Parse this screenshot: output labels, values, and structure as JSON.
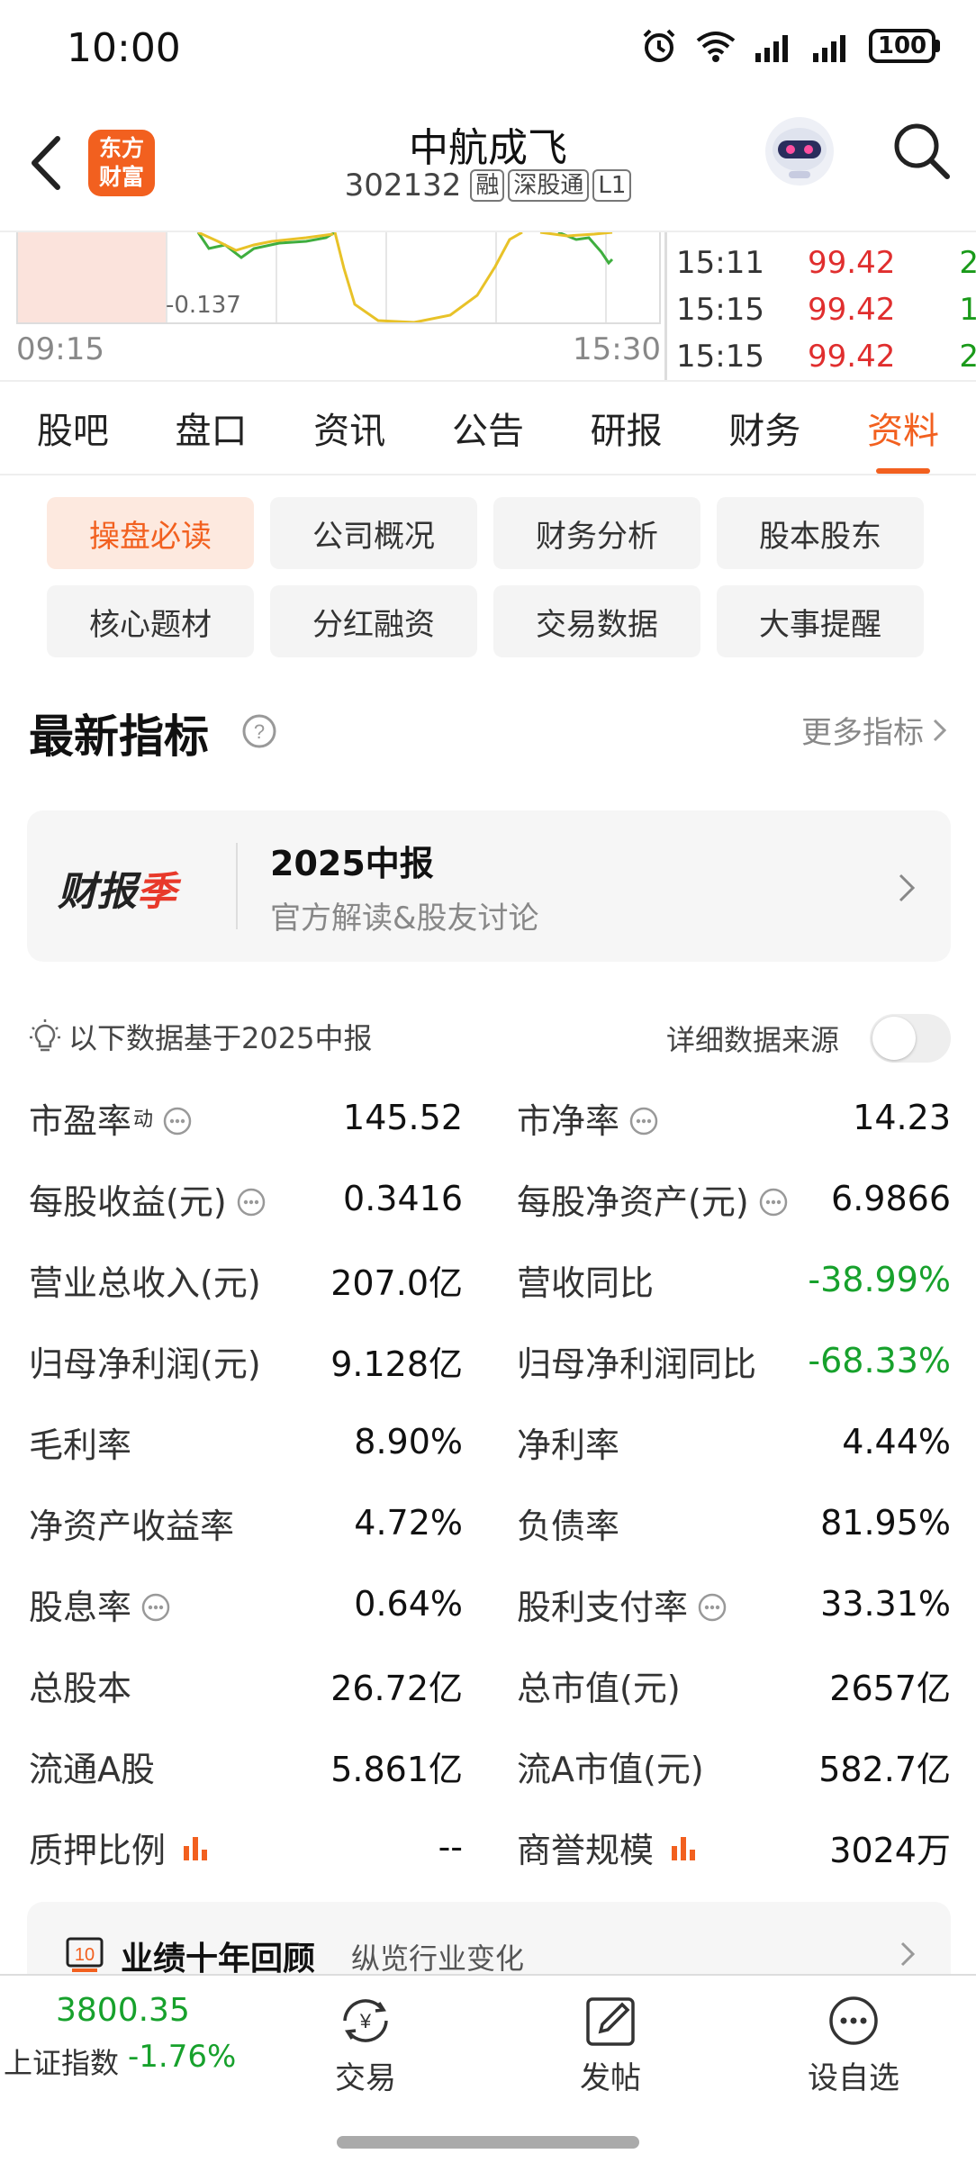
{
  "status_bar": {
    "time": "10:00",
    "battery": "100"
  },
  "header": {
    "app_logo": "东方财富",
    "stock_name": "中航成飞",
    "stock_code": "302132",
    "tags": [
      "融",
      "深股通",
      "L1"
    ]
  },
  "chart_strip": {
    "min_label": "-0.137",
    "time_start": "09:15",
    "time_end": "15:30",
    "ticks": [
      {
        "time": "15:11",
        "price": "99.42",
        "vol": "2"
      },
      {
        "time": "15:15",
        "price": "99.42",
        "vol": "1"
      },
      {
        "time": "15:15",
        "price": "99.42",
        "vol": "2"
      }
    ]
  },
  "tabs": [
    "股吧",
    "盘口",
    "资讯",
    "公告",
    "研报",
    "财务",
    "资料"
  ],
  "active_tab": "资料",
  "subtabs": [
    "操盘必读",
    "公司概况",
    "财务分析",
    "股本股东",
    "核心题材",
    "分红融资",
    "交易数据",
    "大事提醒"
  ],
  "section": {
    "title": "最新指标",
    "more": "更多指标"
  },
  "banner": {
    "logo_black": "财报",
    "logo_red": "季",
    "title": "2025中报",
    "subtitle": "官方解读&股友讨论"
  },
  "note": {
    "text": "以下数据基于2025中报",
    "source_label": "详细数据来源"
  },
  "metrics": [
    {
      "l_label": "市盈率",
      "l_sup": "动",
      "l_info": true,
      "l_value": "145.52",
      "r_label": "市净率",
      "r_info": true,
      "r_value": "14.23"
    },
    {
      "l_label": "每股收益(元)",
      "l_info": true,
      "l_value": "0.3416",
      "r_label": "每股净资产(元)",
      "r_info": true,
      "r_value": "6.9866"
    },
    {
      "l_label": "营业总收入(元)",
      "l_value": "207.0亿",
      "r_label": "营收同比",
      "r_value": "-38.99%",
      "r_green": true
    },
    {
      "l_label": "归母净利润(元)",
      "l_value": "9.128亿",
      "r_label": "归母净利润同比",
      "r_value": "-68.33%",
      "r_green": true
    },
    {
      "l_label": "毛利率",
      "l_value": "8.90%",
      "r_label": "净利率",
      "r_value": "4.44%"
    },
    {
      "l_label": "净资产收益率",
      "l_value": "4.72%",
      "r_label": "负债率",
      "r_value": "81.95%"
    },
    {
      "l_label": "股息率",
      "l_info": true,
      "l_value": "0.64%",
      "r_label": "股利支付率",
      "r_info": true,
      "r_value": "33.31%"
    },
    {
      "l_label": "总股本",
      "l_value": "26.72亿",
      "r_label": "总市值(元)",
      "r_value": "2657亿"
    },
    {
      "l_label": "流通A股",
      "l_value": "5.861亿",
      "r_label": "流A市值(元)",
      "r_value": "582.7亿"
    },
    {
      "l_label": "质押比例",
      "l_bar": true,
      "l_value": "--",
      "r_label": "商誉规模",
      "r_bar": true,
      "r_value": "3024万"
    }
  ],
  "decade": {
    "icon_text": "10",
    "title": "业绩十年回顾",
    "subtitle": "纵览行业变化"
  },
  "bottom_bar": {
    "index_value": "3800.35",
    "index_name": "上证指数",
    "index_change": "-1.76%",
    "trade": "交易",
    "post": "发帖",
    "watchlist": "设自选"
  },
  "colors": {
    "accent": "#f2601f",
    "up": "#e02e2e",
    "down": "#17a12c"
  },
  "icons": [
    "alarm-icon",
    "wifi-icon",
    "signal-icon",
    "battery-icon",
    "back-icon",
    "robot-avatar-icon",
    "search-icon",
    "help-icon",
    "chevron-right-icon",
    "bulb-icon",
    "info-icon",
    "bar-chart-icon",
    "yuan-exchange-icon",
    "edit-icon",
    "more-dots-icon"
  ]
}
